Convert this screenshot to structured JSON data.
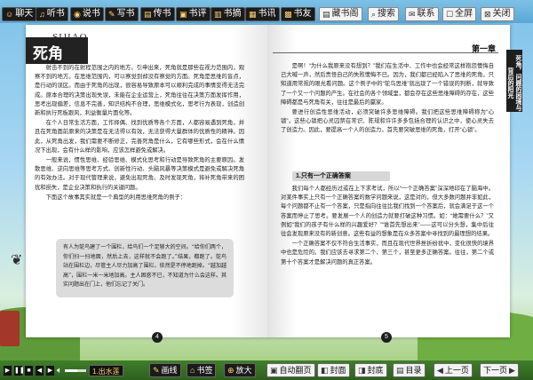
{
  "toolbar": {
    "left_buttons": [
      {
        "label": "聊天",
        "icon": "chat-icon"
      },
      {
        "label": "听书",
        "icon": "headphone-icon"
      },
      {
        "label": "说书",
        "icon": "speech-icon"
      },
      {
        "label": "写书",
        "icon": "pen-icon"
      },
      {
        "label": "传书",
        "icon": "upload-icon"
      },
      {
        "label": "书评",
        "icon": "comment-icon"
      },
      {
        "label": "书摘",
        "icon": "bookmark-icon"
      },
      {
        "label": "书讯",
        "icon": "news-icon"
      },
      {
        "label": "书友",
        "icon": "friends-icon"
      }
    ],
    "right_buttons": [
      {
        "label": "藏书阁",
        "icon": "library-icon"
      },
      {
        "label": "搜索",
        "icon": "search-icon"
      },
      {
        "label": "联系",
        "icon": "mail-icon"
      },
      {
        "label": "全屏",
        "icon": "fullscreen-icon"
      },
      {
        "label": "关闭",
        "icon": "close-icon"
      }
    ]
  },
  "left_page": {
    "chapter_logo": "死角",
    "chapter_en": "SIJIAO",
    "paragraphs": [
      "射击不到的在射程范围之内的地方。引申出来，死角就是那些在视力范围内，观察不到的地方。在思维范围内，可以察觉到却没有察觉的方面。死角是思维的盲点，是行动的误区。而由于死角的出现，很容易导致原本可以顺利完成的事情变得无法完成。原本合理的决策出现失误，未能在企业运营上，死角往往在决策方面发挥作用，思考出现偏差，信息不完善，知识结构不合理，思维模式化，思考行为表现，创造创新和执行死板跟风，利益衡量片面化等。",
      "在个人日常生活方面，工作择偶、找到优质等各个方面，人都容易遇到死角，并且在死角面前原来的决策是在无法得以有效，无法获得大量群体的优质性的精神。因此，从死角出发，我们需要不断修正，完善死角是什么，它有哪些形式，会在什么情况下出现，会有什么样的影响，应该怎样避免或解决。",
      "一般来说，惯性思维、经验思维、模式化思考和行动是导致死角的主要原因。发散思维、逆向思维等思考方式、创新性行动、头脑风暴等决策模式是避免或解决死角的有效办法。对于现代管理来说，避免出现死角、及时发现死角，将补死角带来的困扰和损失，是企业决策和执行的关键问题。",
      "下面这个故事其实就是一个典型的利用思维死角的例子："
    ],
    "quote": "有人为鸵鸟建了一个围栏，给鸟们一个足够大的空间。“给你们两个，你们扫一扫地面，然后上去，这样就不会跑了。”结果，都跑了。鸵鸟站在围栏边，尽管主人尽力加高了围栏，依然是不停地跑掉。“越加越高”，围栏一米一米地加高。主人困惑不已，不知道为什么会这样。其实问题出在门上，他们忘记了关门。",
    "page_number": "4"
  },
  "right_page": {
    "chapter": "第一章",
    "side_tab": "死角，问题的困境与背后的阳光",
    "paragraphs": [
      "是啊！“为什么我原来没有想到？”我们在生活中、工作中也会经常这样抱怨懊悔自己大喊一声，然后责怪自己的失败懊悔不已。因为，我们都已经陷入了思维的死角，只知道用常规的眼光看问题。这个例子中的“鸵鸟思维”就出现了一个错误的判断，就导致了一个又一个问题的产生。在社会的各个领域里，都会存在这些思维障碍的存在，这些障碍都是与死角有关，往往是最后的赢家。",
      "要进行创造性思维活动，必须突破许多思维障碍。我们把这些思维障碍称为“心锁”，这些心锁把心灵囚禁在常识、陈规和许许多多包括合理的认识之中，使心灵失去了创造力。因此，要提高一个人的创造力，首先要突破思维的死角，打开“心锁”。"
    ],
    "subheading": "1.只有一个正确答案",
    "paragraphs2": [
      "我们每个人都经历过或在上下求考试，所以“一个正确答案”深深地印在了脑海中。对某件事实上只有一个正确答案的数学问题来说，这是对的，但大多数问题并非如此，每个问题都不止有一个答案，只是指向往往比我们找到一个答案后，就会满足于这一个答案而停止了思考。要发展一个人的创造力就要打破这种习惯。如：“她需要什么？”又例如“我们的孩子有什么样的兴趣爱好？”“谁首先想出来”——这可以分头想，集中后往往会发现原来没有的新创意。这些有益的想象是在众多答案中寻找到的最理想的结果。",
      "一个正确答案不仅不符合生活事实，而且在现代世界挫折纷扰中，变化很快的境界中也是危险的。我们应该去寻求第二个、第三个，甚至更多正确答案。往往，第二个或第十个答案才是解决问题的真正答案。"
    ],
    "page_number": "5"
  },
  "bottombar": {
    "track_name": "1.出水莲",
    "volume_percent": 60,
    "buttons": [
      {
        "label": "画线",
        "icon": "pencil-icon"
      },
      {
        "label": "书签",
        "icon": "bookmark-icon"
      },
      {
        "label": "放大",
        "icon": "zoom-icon"
      },
      {
        "label": "自动翻页",
        "icon": "autoplay-icon"
      },
      {
        "label": "封面",
        "icon": "cover-icon"
      },
      {
        "label": "封底",
        "icon": "back-cover-icon"
      },
      {
        "label": "目录",
        "icon": "contents-icon"
      },
      {
        "label": "上一页",
        "icon": "prev-icon"
      },
      {
        "label": "下一页",
        "icon": "next-icon"
      }
    ]
  }
}
